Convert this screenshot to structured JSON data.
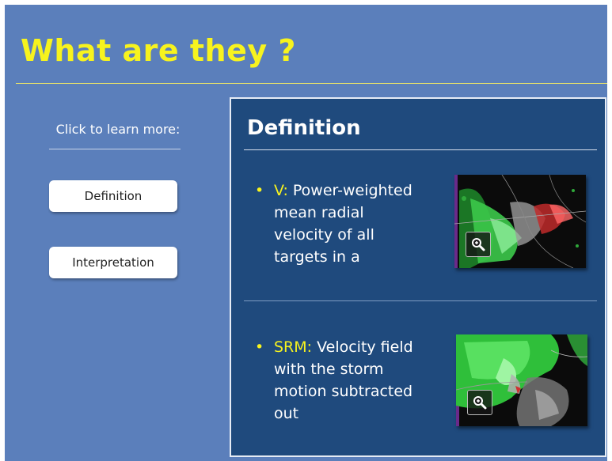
{
  "slide": {
    "title": "What are they ?",
    "click_label": "Click to learn more:",
    "buttons": [
      "Definition",
      "Interpretation"
    ]
  },
  "panel": {
    "title": "Definition",
    "items": [
      {
        "key": "V:",
        "text": " Power-weighted mean radial velocity of all targets in a resolution volume",
        "thumbnail": "radar-velocity-image",
        "zoom_icon": "zoom-in-icon"
      },
      {
        "key": "SRM:",
        "text": " Velocity field with the storm motion subtracted out",
        "thumbnail": "storm-relative-motion-image",
        "zoom_icon": "zoom-in-icon"
      }
    ]
  },
  "colors": {
    "background": "#5b7fbb",
    "panel": "#1f4a7d",
    "accent": "#f7f31e"
  }
}
